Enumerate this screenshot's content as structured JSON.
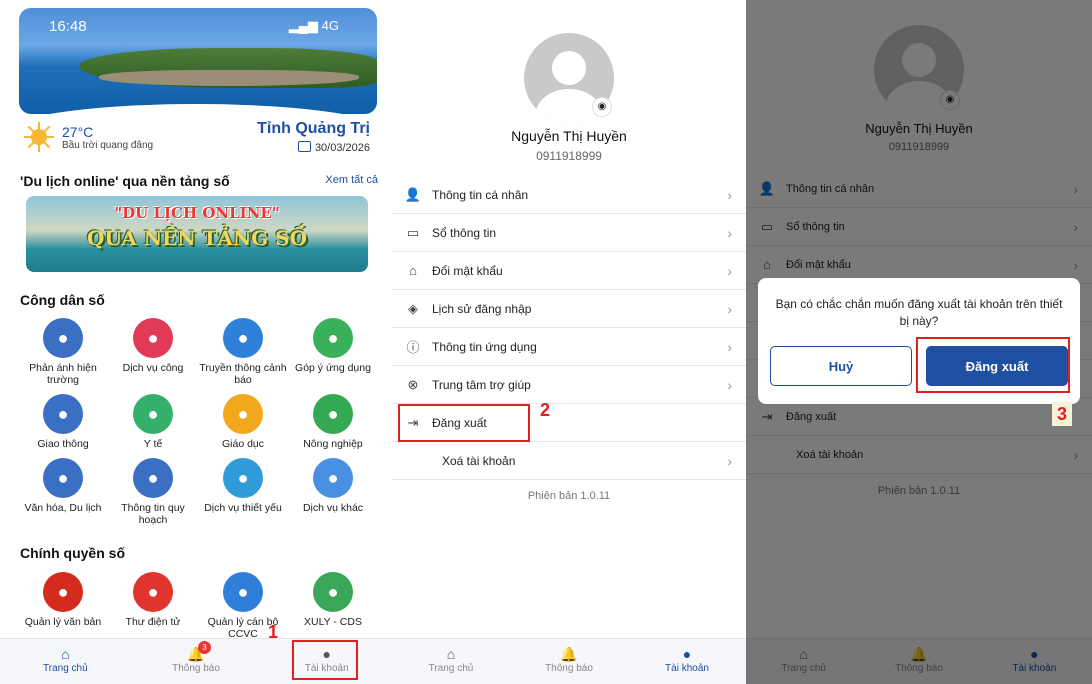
{
  "home": {
    "status_time": "16:48",
    "status_signal": "4G",
    "weather": {
      "temp": "27°C",
      "desc": "Bầu trời quang đãng"
    },
    "province": "Tỉnh Quảng Trị",
    "date": "30/03/2026",
    "tourism_title": "'Du lịch online' qua nền tảng số",
    "see_all": "Xem tất cả",
    "banner_line1": "\"DU LỊCH ONLINE\"",
    "banner_line2": "QUA NỀN TẢNG SỐ",
    "citizen_title": "Công dân số",
    "citizen_items": [
      {
        "label": "Phản ánh hiện trường",
        "icon": "feedback-icon",
        "color": "#3a6fc4"
      },
      {
        "label": "Dịch vụ công",
        "icon": "service-icon",
        "color": "#e23b57"
      },
      {
        "label": "Truyền thông cảnh báo",
        "icon": "megaphone-icon",
        "color": "#2f80d8"
      },
      {
        "label": "Góp ý ứng dụng",
        "icon": "comment-icon",
        "color": "#3bb05a"
      },
      {
        "label": "Giao thông",
        "icon": "traffic-icon",
        "color": "#3a6fc4"
      },
      {
        "label": "Y tế",
        "icon": "health-icon",
        "color": "#34b06b"
      },
      {
        "label": "Giáo dục",
        "icon": "education-icon",
        "color": "#f2a81d"
      },
      {
        "label": "Nông nghiệp",
        "icon": "agriculture-icon",
        "color": "#34a853"
      },
      {
        "label": "Văn hóa, Du lịch",
        "icon": "globe-icon",
        "color": "#3a6fc4"
      },
      {
        "label": "Thông tin quy hoạch",
        "icon": "map-icon",
        "color": "#3a6fc4"
      },
      {
        "label": "Dịch vụ thiết yếu",
        "icon": "water-icon",
        "color": "#2f9bd8"
      },
      {
        "label": "Dịch vụ khác",
        "icon": "apps-icon",
        "color": "#4a90e2"
      }
    ],
    "gov_title": "Chính quyền số",
    "gov_items": [
      {
        "label": "Quản lý văn bản",
        "icon": "emblem-icon",
        "color": "#d52b1e"
      },
      {
        "label": "Thư điện tử",
        "icon": "mail-icon",
        "color": "#e0352f"
      },
      {
        "label": "Quản lý cán bộ CCVC",
        "icon": "user-icon",
        "color": "#2f7fd8"
      },
      {
        "label": "XULY - CDS",
        "icon": "province-logo-icon",
        "color": "#3aa657"
      }
    ],
    "nav": {
      "home": "Trang chủ",
      "notifications": "Thông báo",
      "account": "Tài khoản",
      "badge": "3"
    },
    "step": "1"
  },
  "account": {
    "name": "Nguyễn Thị Huyền",
    "phone": "0911918999",
    "menu": [
      {
        "label": "Thông tin cá nhân",
        "icon": "person-icon",
        "glyph": "👤"
      },
      {
        "label": "Sổ thông tin",
        "icon": "book-icon",
        "glyph": "▭"
      },
      {
        "label": "Đổi mật khẩu",
        "icon": "bag-icon",
        "glyph": "⌂"
      },
      {
        "label": "Lịch sử đăng nhập",
        "icon": "shield-icon",
        "glyph": "◈"
      },
      {
        "label": "Thông tin ứng dụng",
        "icon": "info-icon",
        "glyph": "ⓘ"
      },
      {
        "label": "Trung tâm trợ giúp",
        "icon": "help-icon",
        "glyph": "⊗"
      },
      {
        "label": "Đăng xuất",
        "icon": "logout-icon",
        "glyph": "⇥"
      },
      {
        "label": "Xoá tài khoản",
        "icon": "",
        "glyph": ""
      }
    ],
    "version": "Phiên bản 1.0.11",
    "nav": {
      "home": "Trang chủ",
      "notifications": "Thông báo",
      "account": "Tài khoản"
    },
    "step": "2"
  },
  "dialog": {
    "message": "Bạn có chắc chắn muốn đăng xuất tài khoản trên thiết bị này?",
    "cancel": "Huỷ",
    "confirm": "Đăng xuất",
    "step": "3"
  }
}
